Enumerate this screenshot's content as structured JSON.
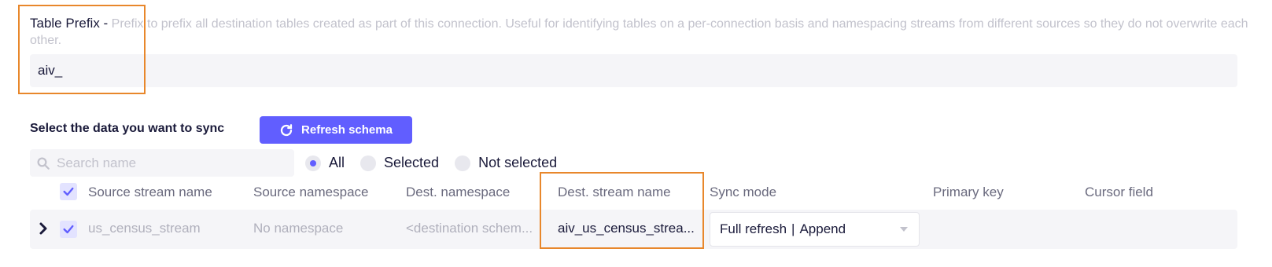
{
  "prefix": {
    "label": "Table Prefix -",
    "description": " Prefix to prefix all destination tables created as part of this connection. Useful for identifying tables on a per-connection basis and namespacing streams from different sources so they do not overwrite each other.",
    "value": "aiv_"
  },
  "sync": {
    "title": "Select the data you want to sync",
    "refresh_label": "Refresh schema",
    "search_placeholder": "Search name",
    "filters": [
      "All",
      "Selected",
      "Not selected"
    ],
    "selected_filter": "All"
  },
  "table": {
    "columns": [
      "Source stream name",
      "Source namespace",
      "Dest. namespace",
      "Dest. stream name",
      "Sync mode",
      "Primary key",
      "Cursor field"
    ],
    "rows": [
      {
        "source_stream": "us_census_stream",
        "source_namespace": "No namespace",
        "dest_namespace": "<destination schem...",
        "dest_stream": "aiv_us_census_strea...",
        "sync_mode_a": "Full refresh",
        "sync_mode_b": "Append",
        "primary_key": "",
        "cursor_field": ""
      }
    ]
  },
  "colors": {
    "accent": "#615eff",
    "highlight": "#e8872b",
    "text": "#1a1a3a",
    "muted": "#b0b0bc"
  },
  "icons": [
    "refresh-icon",
    "search-icon",
    "check-icon",
    "chevron-right-icon",
    "caret-down-icon"
  ]
}
